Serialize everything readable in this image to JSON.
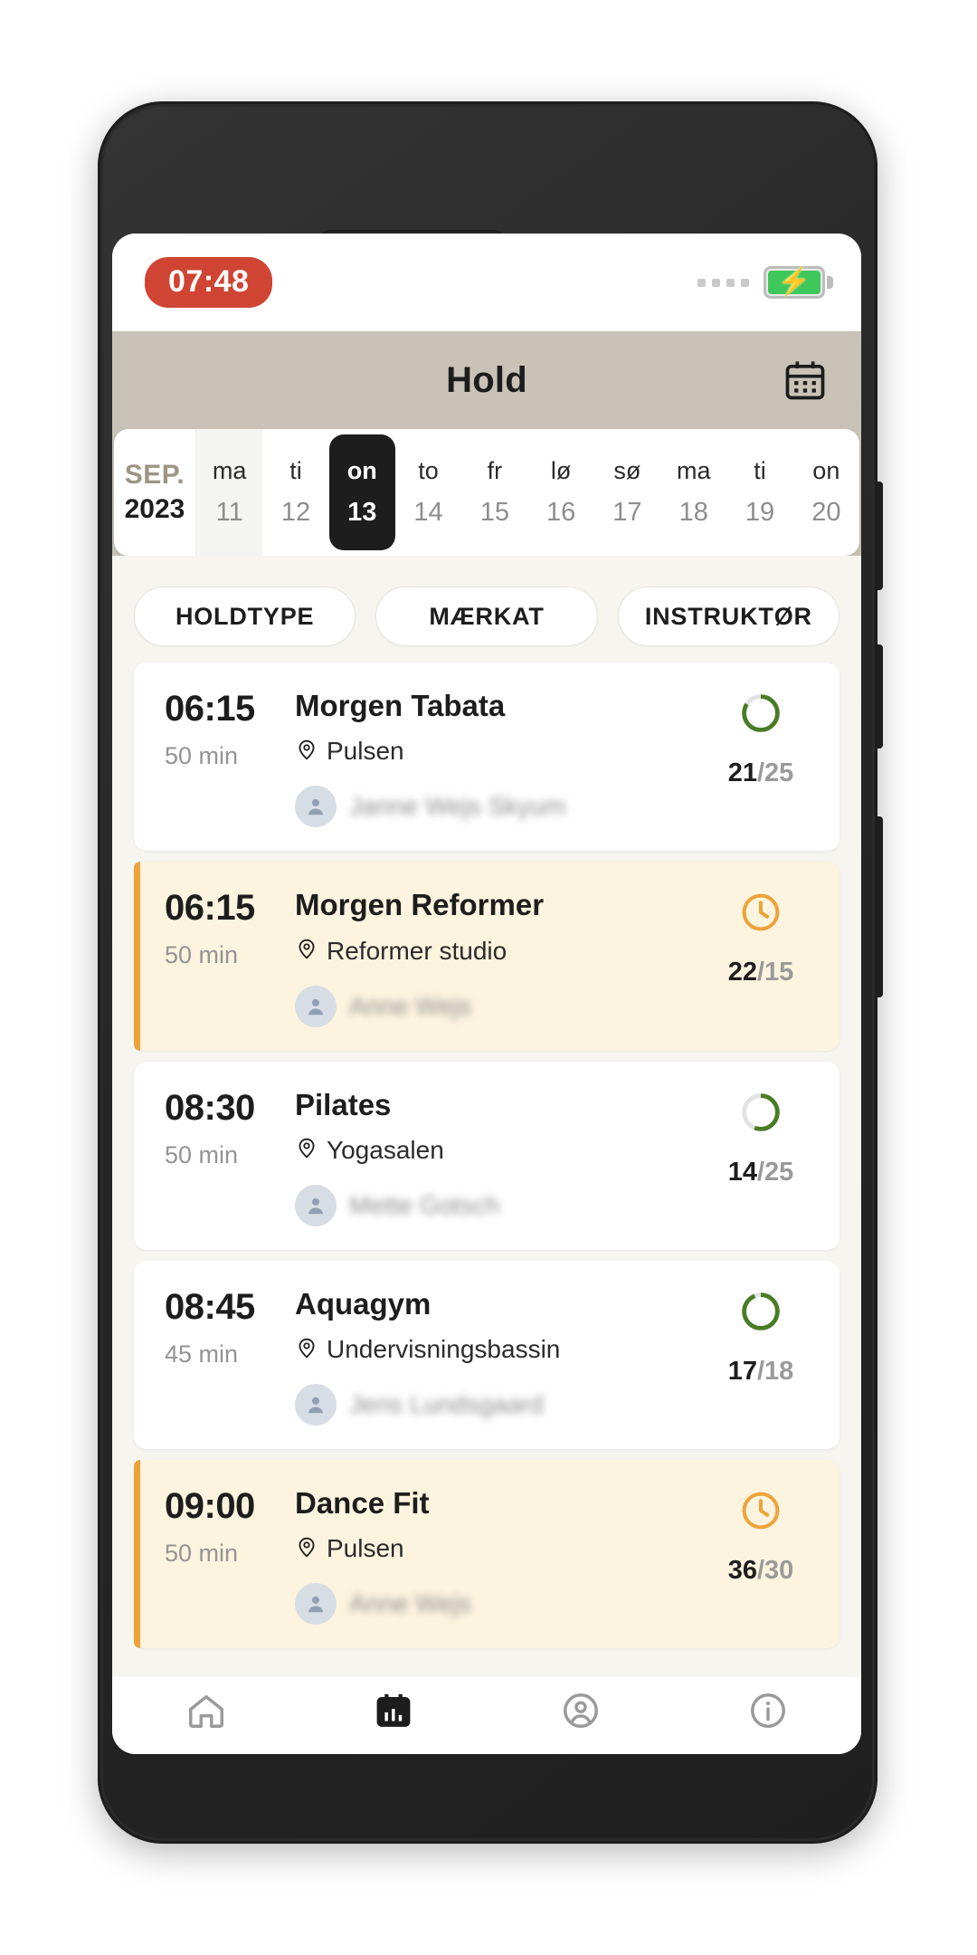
{
  "status_bar": {
    "clock": "07:48",
    "battery_icon": "battery-charging-icon",
    "signal_dots": 4
  },
  "app_bar": {
    "title": "Hold",
    "calendar_icon": "calendar-icon"
  },
  "date_strip": {
    "month": "SEP.",
    "year": "2023",
    "days": [
      {
        "dow": "ma",
        "num": "11",
        "selected": false,
        "highlight": true
      },
      {
        "dow": "ti",
        "num": "12",
        "selected": false,
        "highlight": false
      },
      {
        "dow": "on",
        "num": "13",
        "selected": true,
        "highlight": false
      },
      {
        "dow": "to",
        "num": "14",
        "selected": false,
        "highlight": false
      },
      {
        "dow": "fr",
        "num": "15",
        "selected": false,
        "highlight": false
      },
      {
        "dow": "lø",
        "num": "16",
        "selected": false,
        "highlight": false
      },
      {
        "dow": "sø",
        "num": "17",
        "selected": false,
        "highlight": false
      },
      {
        "dow": "ma",
        "num": "18",
        "selected": false,
        "highlight": false
      },
      {
        "dow": "ti",
        "num": "19",
        "selected": false,
        "highlight": false
      },
      {
        "dow": "on",
        "num": "20",
        "selected": false,
        "highlight": false
      }
    ]
  },
  "filters": [
    {
      "label": "HOLDTYPE"
    },
    {
      "label": "MÆRKAT"
    },
    {
      "label": "INSTRUKTØR"
    }
  ],
  "classes": [
    {
      "time": "06:15",
      "duration": "50 min",
      "name": "Morgen Tabata",
      "location": "Pulsen",
      "instructor": "Janne Wejs Skyum",
      "booked": "21",
      "capacity": "25",
      "status": "open",
      "status_icon": "ring-progress-icon",
      "fill_percent": 84
    },
    {
      "time": "06:15",
      "duration": "50 min",
      "name": "Morgen Reformer",
      "location": "Reformer studio",
      "instructor": "Anne Wejs",
      "booked": "22",
      "capacity": "15",
      "status": "waitlist",
      "status_icon": "clock-icon",
      "fill_percent": 100
    },
    {
      "time": "08:30",
      "duration": "50 min",
      "name": "Pilates",
      "location": "Yogasalen",
      "instructor": "Mette Gotsch",
      "booked": "14",
      "capacity": "25",
      "status": "open",
      "status_icon": "ring-progress-icon",
      "fill_percent": 56
    },
    {
      "time": "08:45",
      "duration": "45 min",
      "name": "Aquagym",
      "location": "Undervisningsbassin",
      "instructor": "Jens Lundsgaard",
      "booked": "17",
      "capacity": "18",
      "status": "open",
      "status_icon": "ring-progress-icon",
      "fill_percent": 94
    },
    {
      "time": "09:00",
      "duration": "50 min",
      "name": "Dance Fit",
      "location": "Pulsen",
      "instructor": "Anne Wejs",
      "booked": "36",
      "capacity": "30",
      "status": "waitlist",
      "status_icon": "clock-icon",
      "fill_percent": 100
    }
  ],
  "bottom_nav": [
    {
      "icon": "home-icon",
      "active": false
    },
    {
      "icon": "calendar-icon",
      "active": true
    },
    {
      "icon": "person-circle-icon",
      "active": false
    },
    {
      "icon": "info-circle-icon",
      "active": false
    }
  ],
  "colors": {
    "accent_beige": "#c9c2b6",
    "waitlist_bg": "#fdf4df",
    "waitlist_accent": "#eda33a",
    "open_green": "#4a7c26",
    "clock_red": "#cf4432",
    "page_bg": "#f6f5f0"
  }
}
